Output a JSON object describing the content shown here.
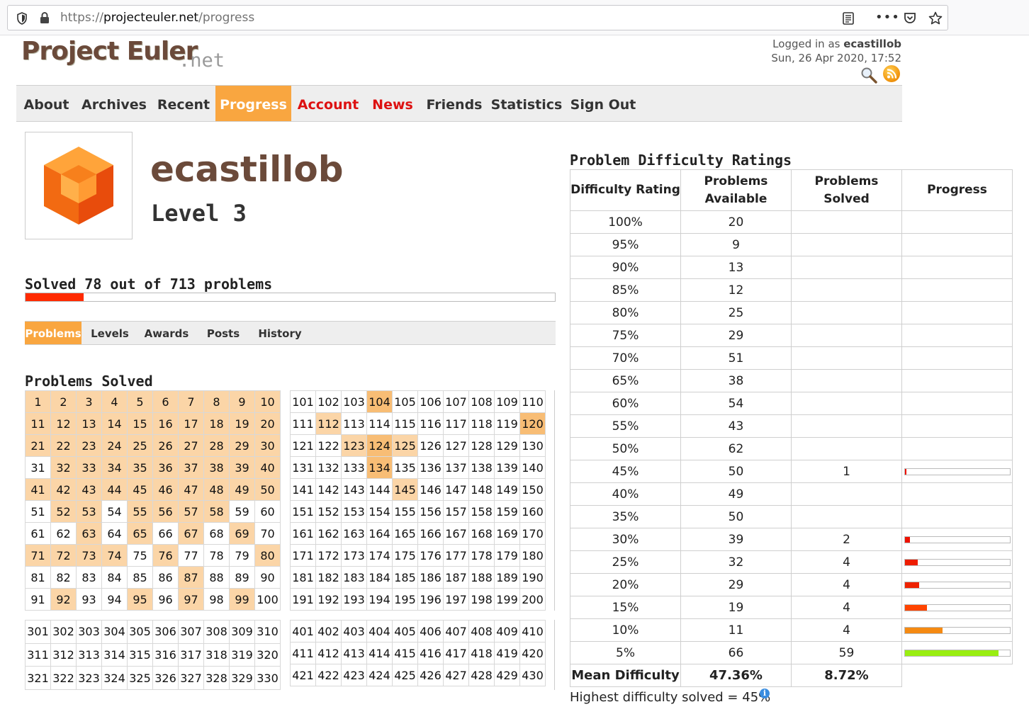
{
  "browser": {
    "url_scheme": "https://",
    "url_host": "projecteuler.net",
    "url_path": "/progress"
  },
  "header": {
    "logo_main": "Project Euler",
    "logo_sub": ".net",
    "logged_in_prefix": "Logged in as ",
    "logged_in_user": "ecastillob",
    "datetime": "Sun, 26 Apr 2020, 17:52"
  },
  "nav": [
    {
      "label": "About",
      "style": "normal"
    },
    {
      "label": "Archives",
      "style": "normal"
    },
    {
      "label": "Recent",
      "style": "normal"
    },
    {
      "label": "Progress",
      "style": "active"
    },
    {
      "label": "Account",
      "style": "red"
    },
    {
      "label": "News",
      "style": "red"
    },
    {
      "label": "Friends",
      "style": "normal"
    },
    {
      "label": "Statistics",
      "style": "normal"
    },
    {
      "label": "Sign Out",
      "style": "normal"
    }
  ],
  "profile": {
    "username": "ecastillob",
    "level": "Level 3",
    "solved_text": "Solved 78 out of 713 problems",
    "solved": 78,
    "total": 713
  },
  "subtabs": [
    {
      "label": "Problems",
      "active": true
    },
    {
      "label": "Levels",
      "active": false
    },
    {
      "label": "Awards",
      "active": false
    },
    {
      "label": "Posts",
      "active": false
    },
    {
      "label": "History",
      "active": false
    }
  ],
  "problems": {
    "heading": "Problems Solved",
    "solved": [
      1,
      2,
      3,
      4,
      5,
      6,
      7,
      8,
      9,
      10,
      11,
      12,
      13,
      14,
      15,
      16,
      17,
      18,
      19,
      20,
      21,
      22,
      23,
      24,
      25,
      26,
      27,
      28,
      29,
      30,
      32,
      33,
      34,
      35,
      36,
      37,
      38,
      39,
      40,
      41,
      42,
      43,
      44,
      45,
      46,
      47,
      48,
      49,
      50,
      52,
      53,
      55,
      56,
      57,
      58,
      63,
      65,
      67,
      69,
      71,
      72,
      73,
      74,
      76,
      80,
      87,
      92,
      95,
      97,
      99,
      104,
      112,
      120,
      123,
      124,
      125,
      134,
      145
    ],
    "hot": [
      104,
      120,
      124,
      134
    ]
  },
  "difficulty": {
    "heading": "Problem Difficulty Ratings",
    "headers": [
      "Difficulty Rating",
      "Problems Available",
      "Problems Solved",
      "Progress"
    ],
    "rows": [
      {
        "rating": "100%",
        "available": "20",
        "solved": "",
        "fraction": null
      },
      {
        "rating": "95%",
        "available": "9",
        "solved": "",
        "fraction": null
      },
      {
        "rating": "90%",
        "available": "13",
        "solved": "",
        "fraction": null
      },
      {
        "rating": "85%",
        "available": "12",
        "solved": "",
        "fraction": null
      },
      {
        "rating": "80%",
        "available": "25",
        "solved": "",
        "fraction": null
      },
      {
        "rating": "75%",
        "available": "29",
        "solved": "",
        "fraction": null
      },
      {
        "rating": "70%",
        "available": "51",
        "solved": "",
        "fraction": null
      },
      {
        "rating": "65%",
        "available": "38",
        "solved": "",
        "fraction": null
      },
      {
        "rating": "60%",
        "available": "54",
        "solved": "",
        "fraction": null
      },
      {
        "rating": "55%",
        "available": "43",
        "solved": "",
        "fraction": null
      },
      {
        "rating": "50%",
        "available": "62",
        "solved": "",
        "fraction": null
      },
      {
        "rating": "45%",
        "available": "50",
        "solved": "1",
        "fraction": 0.02,
        "color": "#ee1100"
      },
      {
        "rating": "40%",
        "available": "49",
        "solved": "",
        "fraction": null
      },
      {
        "rating": "35%",
        "available": "50",
        "solved": "",
        "fraction": null
      },
      {
        "rating": "30%",
        "available": "39",
        "solved": "2",
        "fraction": 0.051,
        "color": "#ee1100"
      },
      {
        "rating": "25%",
        "available": "32",
        "solved": "4",
        "fraction": 0.125,
        "color": "#ee1d00"
      },
      {
        "rating": "20%",
        "available": "29",
        "solved": "4",
        "fraction": 0.138,
        "color": "#ee2200"
      },
      {
        "rating": "15%",
        "available": "19",
        "solved": "4",
        "fraction": 0.21,
        "color": "#ff4400"
      },
      {
        "rating": "10%",
        "available": "11",
        "solved": "4",
        "fraction": 0.364,
        "color": "#f58a12"
      },
      {
        "rating": "5%",
        "available": "66",
        "solved": "59",
        "fraction": 0.894,
        "color": "#99ee11"
      }
    ],
    "mean": {
      "label": "Mean Difficulty",
      "available": "47.36%",
      "solved": "8.72%"
    },
    "highest": "Highest difficulty solved = 45%"
  }
}
